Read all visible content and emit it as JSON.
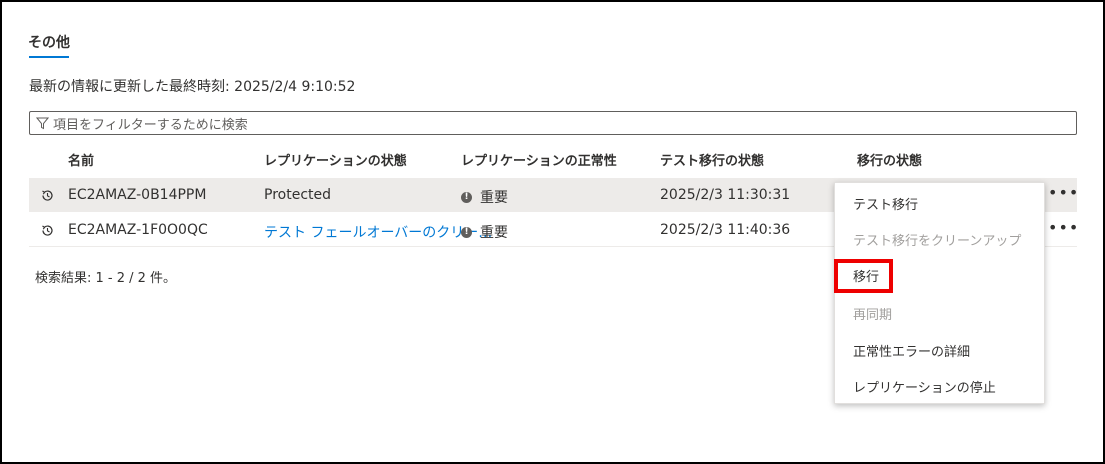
{
  "section": {
    "tab_label": "その他",
    "last_updated": "最新の情報に更新した最終時刻: 2025/2/4 9:10:52"
  },
  "filter": {
    "placeholder": "項目をフィルターするために検索",
    "icon": "filter-icon"
  },
  "table": {
    "headers": [
      "名前",
      "レプリケーションの状態",
      "レプリケーションの正常性",
      "テスト移行の状態",
      "移行の状態"
    ],
    "rows": [
      {
        "name": "EC2AMAZ-0B14PPM",
        "replication_state": "Protected",
        "health": "重要",
        "test_migration": "2025/2/3 11:30:31",
        "selected": true
      },
      {
        "name": "EC2AMAZ-1F0O0QC",
        "replication_state": "テスト フェールオーバーのクリー…",
        "health": "重要",
        "test_migration": "2025/2/3 11:40:36",
        "selected": false
      }
    ],
    "more_label": "•••"
  },
  "results": "検索結果: 1 - 2 / 2 件。",
  "context_menu": {
    "items": [
      {
        "label": "テスト移行",
        "disabled": false
      },
      {
        "label": "テスト移行をクリーンアップ",
        "disabled": true
      },
      {
        "label": "移行",
        "disabled": false,
        "highlighted": true
      },
      {
        "label": "再同期",
        "disabled": true
      },
      {
        "label": "正常性エラーの詳細",
        "disabled": false
      },
      {
        "label": "レプリケーションの停止",
        "disabled": false
      }
    ]
  },
  "colors": {
    "accent": "#0078d4",
    "highlight_box": "#ee0000",
    "selected_row": "#edebe9"
  }
}
